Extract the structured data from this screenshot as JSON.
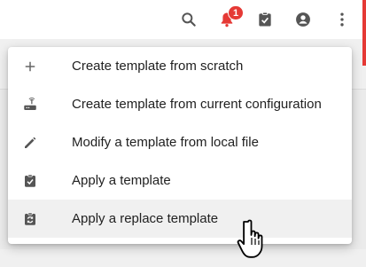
{
  "toolbar": {
    "icons": [
      "search-icon",
      "bell-icon",
      "clipboard-check-icon",
      "account-circle-icon",
      "more-vert-icon"
    ],
    "notification_count": "1",
    "accent_color": "#e53935"
  },
  "menu": {
    "items": [
      {
        "label": "Create template from scratch",
        "icon": "plus-icon"
      },
      {
        "label": "Create template from current configuration",
        "icon": "router-icon"
      },
      {
        "label": "Modify a template from local file",
        "icon": "pencil-icon"
      },
      {
        "label": "Apply a template",
        "icon": "clipboard-check-icon"
      },
      {
        "label": "Apply a replace template",
        "icon": "clipboard-swap-icon"
      }
    ],
    "hovered_index": 4
  }
}
